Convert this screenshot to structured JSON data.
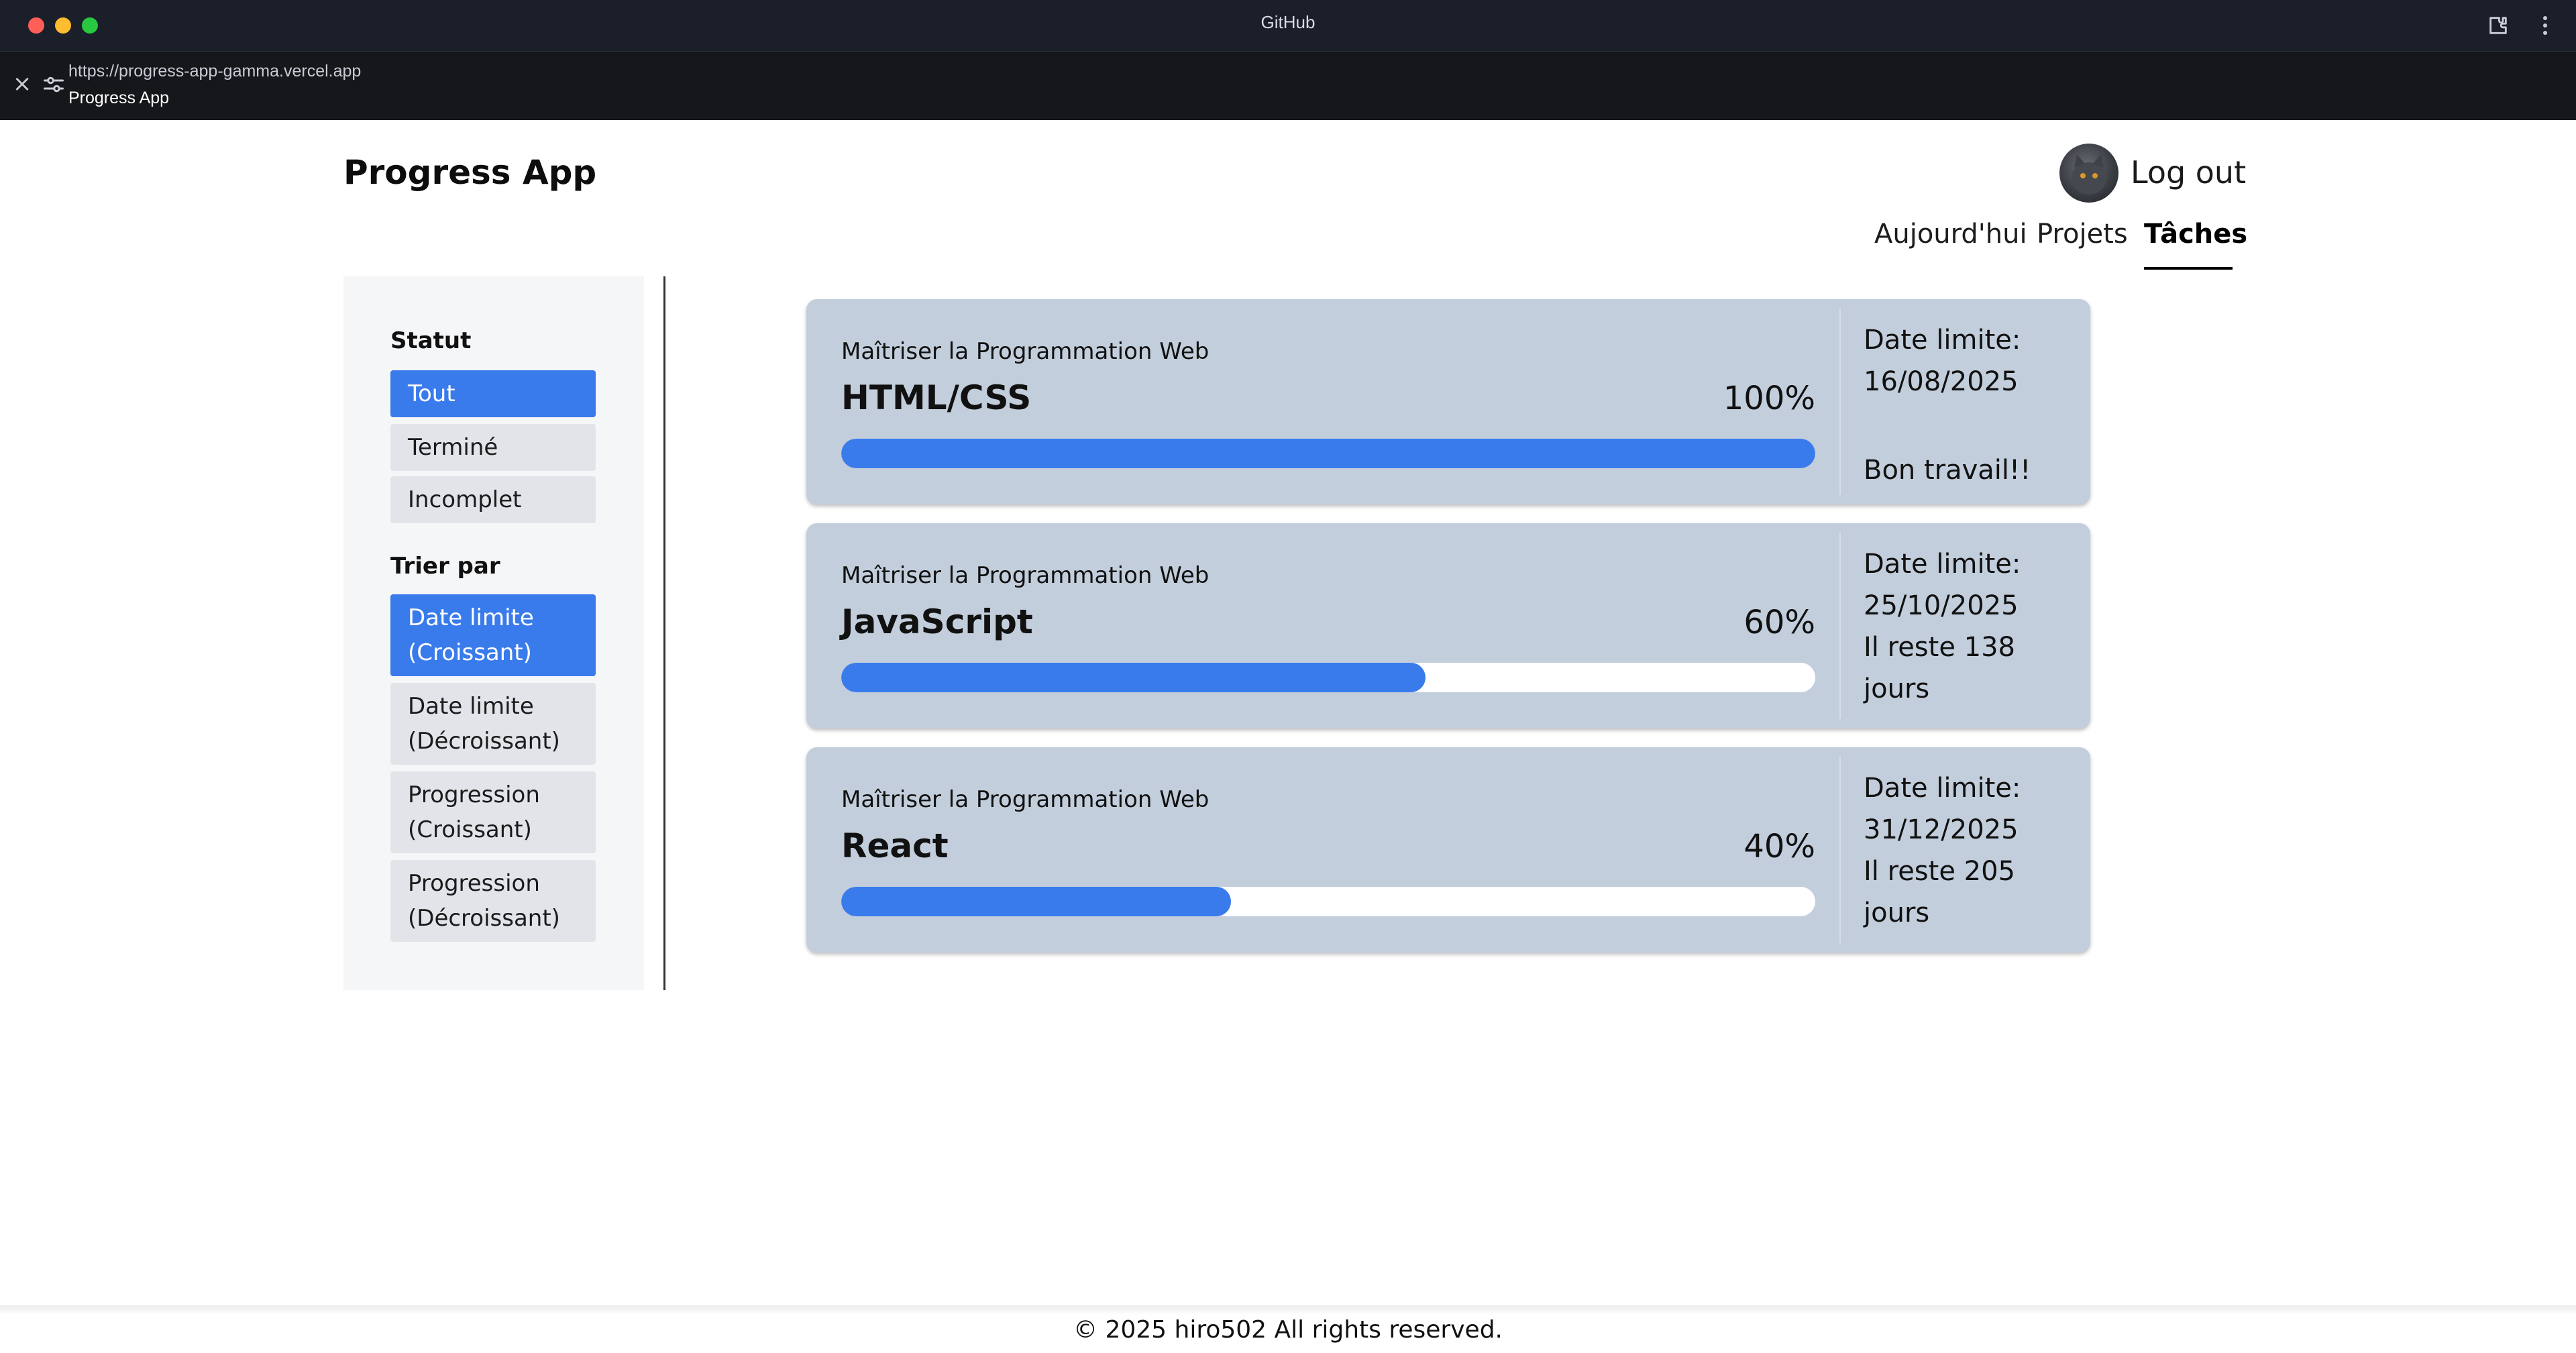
{
  "window": {
    "title": "GitHub",
    "url": "https://progress-app-gamma.vercel.app",
    "page_name": "Progress App"
  },
  "header": {
    "app_title": "Progress App",
    "logout_label": "Log out",
    "nav": {
      "today": "Aujourd'hui",
      "projects": "Projets",
      "tasks": "Tâches",
      "active": "tasks"
    }
  },
  "sidebar": {
    "status_heading": "Statut",
    "status_filters": [
      "Tout",
      "Terminé",
      "Incomplet"
    ],
    "status_active": "Tout",
    "sort_heading": "Trier par",
    "sort_options": [
      {
        "line1": "Date limite",
        "line2": "(Croissant)"
      },
      {
        "line1": "Date limite",
        "line2": "(Décroissant)"
      },
      {
        "line1": "Progression",
        "line2": "(Croissant)"
      },
      {
        "line1": "Progression",
        "line2": "(Décroissant)"
      }
    ],
    "sort_active": "Date limite (Croissant)"
  },
  "tasks": [
    {
      "project": "Maîtriser la Programmation Web",
      "title": "HTML/CSS",
      "progress_label": "100%",
      "progress": 1.0,
      "deadline_label": "Date limite:",
      "deadline": "16/08/2025",
      "note": "Bon travail!!"
    },
    {
      "project": "Maîtriser la Programmation Web",
      "title": "JavaScript",
      "progress_label": "60%",
      "progress": 0.6,
      "deadline_label": "Date limite:",
      "deadline": "25/10/2025",
      "note": "Il reste 138 jours"
    },
    {
      "project": "Maîtriser la Programmation Web",
      "title": "React",
      "progress_label": "40%",
      "progress": 0.4,
      "deadline_label": "Date limite:",
      "deadline": "31/12/2025",
      "note": "Il reste 205 jours"
    }
  ],
  "footer": {
    "copyright": "© 2025 hiro502 All rights reserved."
  },
  "colors": {
    "accent": "#3a7bec",
    "card_bg": "#c3cedc",
    "chrome_bg": "#1b1f2a"
  }
}
